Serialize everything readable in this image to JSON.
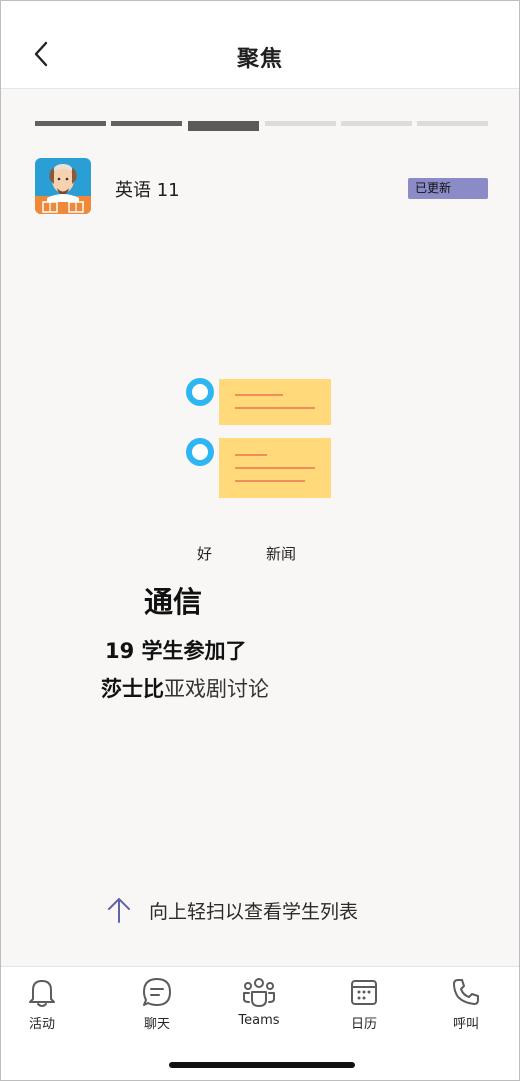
{
  "header": {
    "title": "聚焦"
  },
  "progress": {
    "total": 6,
    "current": 3
  },
  "class_card": {
    "name": "英语 11",
    "badge": "已更新"
  },
  "story": {
    "tag_left": "好",
    "tag_right": "新闻",
    "headline": "通信",
    "stat": "19 学生参加了",
    "detail_bold": "莎士比",
    "detail_rest": "亚戏剧讨论"
  },
  "swipe": {
    "label": "向上轻扫以查看学生列表"
  },
  "nav": {
    "activity": "活动",
    "chat": "聊天",
    "teams": "Teams",
    "calendar": "日历",
    "calls": "呼叫"
  },
  "colors": {
    "accent": "#8b8cc7",
    "note_yellow": "#ffd97a",
    "note_line": "#f28c5a",
    "dot_blue": "#2db6f2",
    "nav_icon": "#5c5c5c"
  }
}
